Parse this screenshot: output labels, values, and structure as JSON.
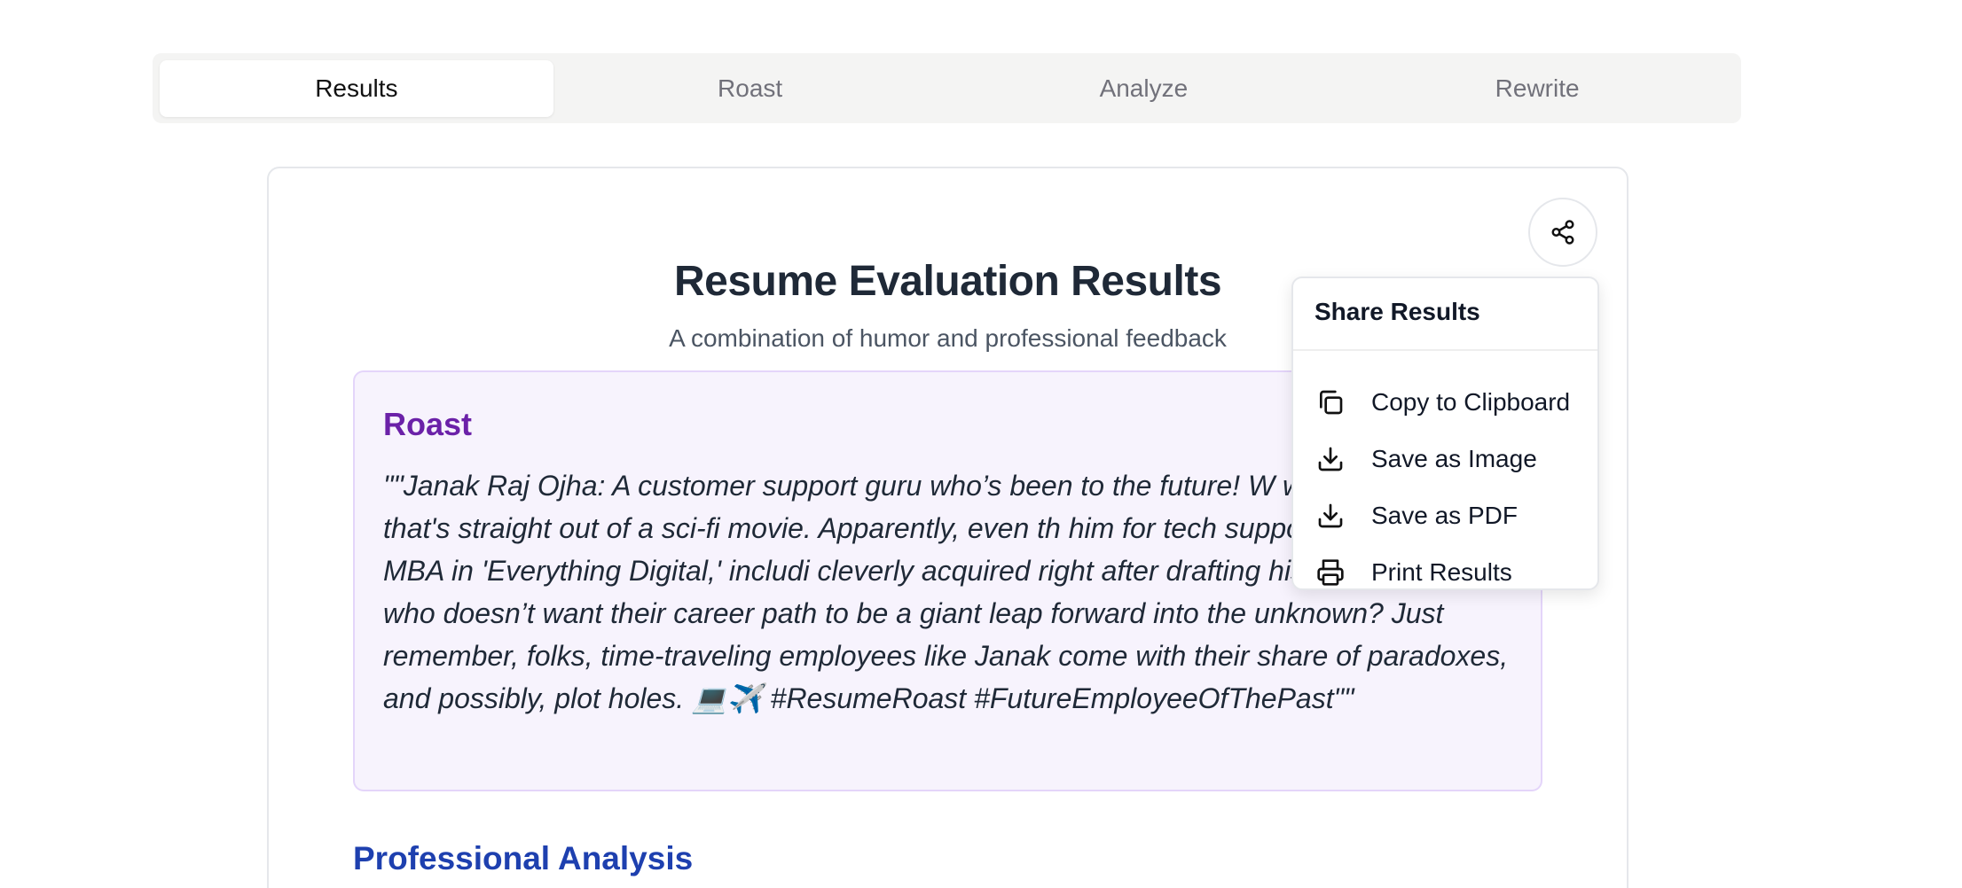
{
  "tabs": [
    {
      "label": "Results",
      "active": true
    },
    {
      "label": "Roast",
      "active": false
    },
    {
      "label": "Analyze",
      "active": false
    },
    {
      "label": "Rewrite",
      "active": false
    }
  ],
  "results": {
    "title": "Resume Evaluation Results",
    "subtitle": "A combination of humor and professional feedback",
    "roast": {
      "heading": "Roast",
      "text": "\"\"Janak Raj Ojha: A customer support guru who’s been to the future! W with experience that's straight out of a sci-fi movie. Apparently, even th him for tech support. Armed with an MBA in 'Everything Digital,' includi cleverly acquired right after drafting his resume. I mean, who doesn’t want their career path to be a giant leap forward into the unknown? Just remember, folks, time-traveling employees like Janak come with their share of paradoxes, and possibly, plot holes. 💻✈️ #ResumeRoast #FutureEmployeeOfThePast\"\""
    },
    "analysis_heading": "Professional Analysis"
  },
  "share_menu": {
    "button_icon": "share-icon",
    "title": "Share Results",
    "items": [
      {
        "label": "Copy to Clipboard",
        "icon": "copy-icon"
      },
      {
        "label": "Save as Image",
        "icon": "download-icon"
      },
      {
        "label": "Save as PDF",
        "icon": "download-icon"
      },
      {
        "label": "Print Results",
        "icon": "printer-icon"
      }
    ]
  },
  "colors": {
    "roast_heading": "#6b21a8",
    "roast_bg": "#f7f3fd",
    "analysis_heading": "#1e40af",
    "tab_bar_bg": "#f4f4f3"
  }
}
